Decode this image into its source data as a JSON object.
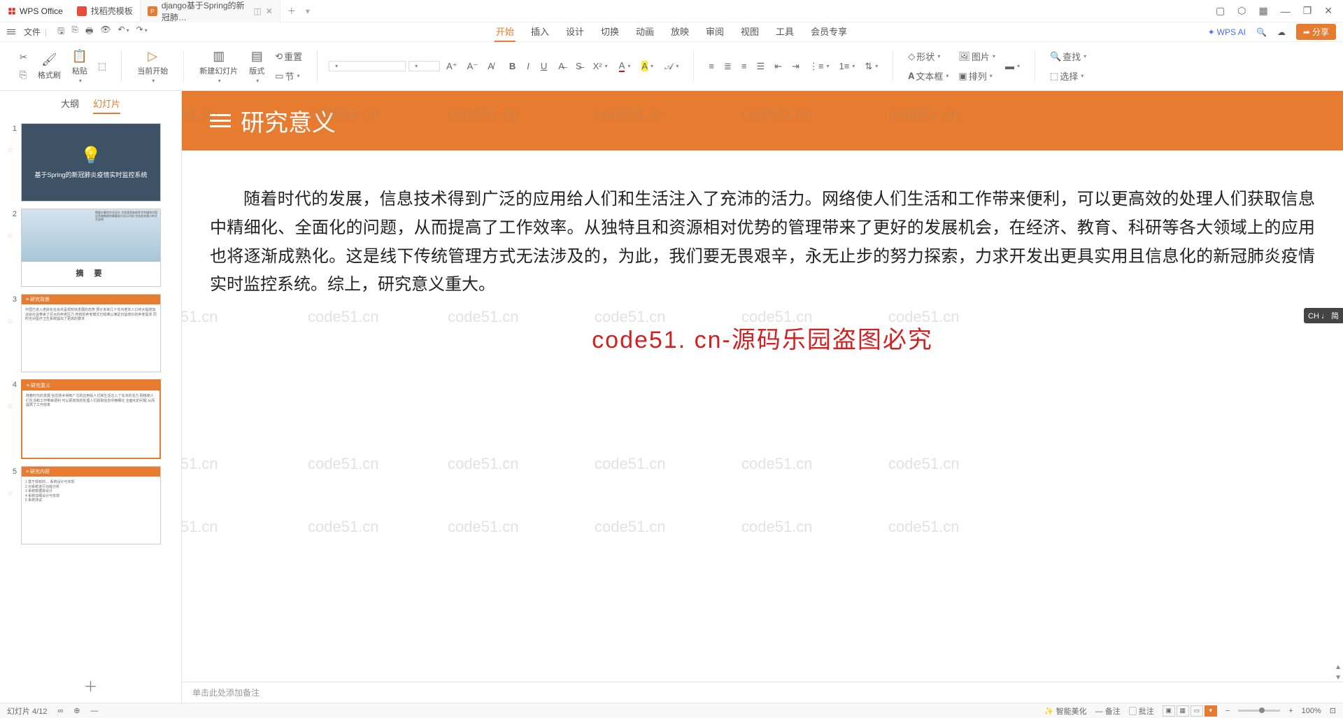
{
  "app_name": "WPS Office",
  "tabs": [
    {
      "label": "找稻壳模板"
    },
    {
      "label": "django基于Spring的新冠肺…"
    }
  ],
  "file_menu": "文件",
  "ribbon_tabs": {
    "start": "开始",
    "insert": "插入",
    "design": "设计",
    "transition": "切换",
    "animation": "动画",
    "slideshow": "放映",
    "review": "审阅",
    "view": "视图",
    "tools": "工具",
    "member": "会员专享"
  },
  "wps_ai": "WPS AI",
  "share": "分享",
  "ribbon": {
    "format_painter": "格式刷",
    "paste": "粘贴",
    "from_current": "当前开始",
    "new_slide": "新建幻灯片",
    "layout": "版式",
    "section": "节",
    "reset": "重置",
    "shape": "形状",
    "picture": "图片",
    "textbox": "文本框",
    "arrange": "排列",
    "find": "查找",
    "select": "选择"
  },
  "side_tabs": {
    "outline": "大纲",
    "slides": "幻灯片"
  },
  "thumbs": {
    "t1": "基于Spring的新冠肺炎疫情实时监控系统",
    "t2_caption": "摘    要",
    "t3_title": "≡ 研究背景",
    "t4_title": "≡ 研究意义",
    "t5_title": "≡ 研究内容"
  },
  "slide": {
    "title": "研究意义",
    "body": "随着时代的发展，信息技术得到广泛的应用给人们和生活注入了充沛的活力。网络使人们生活和工作带来便利，可以更高效的处理人们获取信息中精细化、全面化的问题，从而提高了工作效率。从独特且和资源相对优势的管理带来了更好的发展机会，在经济、教育、科研等各大领域上的应用也将逐渐成熟化。这是线下传统管理方式无法涉及的，为此，我们要无畏艰辛，永无止步的努力探索，力求开发出更具实用且信息化的新冠肺炎疫情实时监控系统。综上，研究意义重大。",
    "watermark_red": "code51. cn-源码乐园盗图必究"
  },
  "notes_placeholder": "单击此处添加备注",
  "status": {
    "slide_info": "幻灯片 4/12",
    "smart": "智能美化",
    "notes": "备注",
    "comments": "批注",
    "zoom": "100%"
  },
  "ime": "CH ♩ 简",
  "watermark_text": "code51.cn"
}
